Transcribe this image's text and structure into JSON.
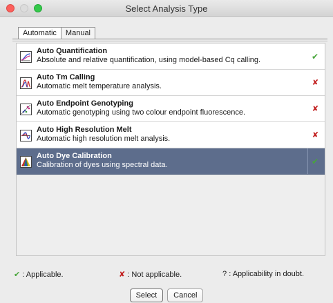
{
  "window": {
    "title": "Select Analysis Type"
  },
  "tabs": [
    {
      "label": "Automatic",
      "active": true
    },
    {
      "label": "Manual",
      "active": false
    }
  ],
  "analyses": [
    {
      "name": "Auto Quantification",
      "description": "Absolute and relative quantification, using model-based Cq calling.",
      "status": "✔",
      "icon": "quantification-icon",
      "selected": false
    },
    {
      "name": "Auto Tm Calling",
      "description": "Automatic melt temperature analysis.",
      "status": "✘",
      "icon": "melt-peak-icon",
      "selected": false
    },
    {
      "name": "Auto Endpoint Genotyping",
      "description": "Automatic genotyping using two colour endpoint fluorescence.",
      "status": "✘",
      "icon": "genotyping-icon",
      "selected": false
    },
    {
      "name": "Auto High Resolution Melt",
      "description": "Automatic high resolution melt analysis.",
      "status": "✘",
      "icon": "hrm-icon",
      "selected": false
    },
    {
      "name": "Auto Dye Calibration",
      "description": "Calibration of dyes using spectral data.",
      "status": "✔",
      "icon": "dye-calibration-icon",
      "selected": true
    }
  ],
  "legend": {
    "applicable_mark": "✔",
    "applicable_text": ": Applicable.",
    "not_applicable_mark": "✘",
    "not_applicable_text": ": Not applicable.",
    "doubt_mark": "?",
    "doubt_text": ": Applicability in doubt."
  },
  "buttons": {
    "select": "Select",
    "cancel": "Cancel"
  },
  "colors": {
    "selected_row": "#5d6d8c",
    "applicable": "#47a53a",
    "not_applicable": "#c11d1d"
  }
}
